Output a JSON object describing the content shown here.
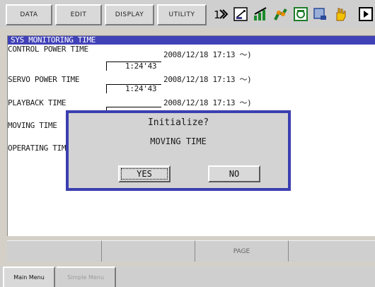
{
  "menu": {
    "data": "DATA",
    "edit": "EDIT",
    "display": "DISPLAY",
    "utility": "UTILITY"
  },
  "status_icons": [
    "tool-number-icon",
    "edit-lock-icon",
    "play-mode-icon",
    "robot-icon",
    "cycle-icon",
    "step-icon",
    "hand-icon",
    "run-icon"
  ],
  "panel": {
    "title": "SYS MONITORING TIME",
    "rows": [
      {
        "label": "CONTROL POWER TIME",
        "date": "2008/12/18 17:13 ～)",
        "time": "1:24'43"
      },
      {
        "label": "SERVO POWER TIME",
        "date": "2008/12/18 17:13 ～)",
        "time": "1:24'43"
      },
      {
        "label": "PLAYBACK TIME",
        "date": "2008/12/18 17:13 ～)"
      },
      {
        "label": "MOVING TIME"
      },
      {
        "label": "OPERATING TIME"
      }
    ]
  },
  "dialog": {
    "title": "Initialize?",
    "message": "MOVING TIME",
    "yes": "YES",
    "no": "NO"
  },
  "function_bar": {
    "keys": [
      "",
      "",
      "PAGE",
      ""
    ]
  },
  "tabs": {
    "main_menu": "Main Menu",
    "simple_menu": "Simple Menu"
  },
  "colors": {
    "title_bar": "#4141b8",
    "dialog_frame": "#3b3fb0",
    "background": "#d4d0c8"
  }
}
